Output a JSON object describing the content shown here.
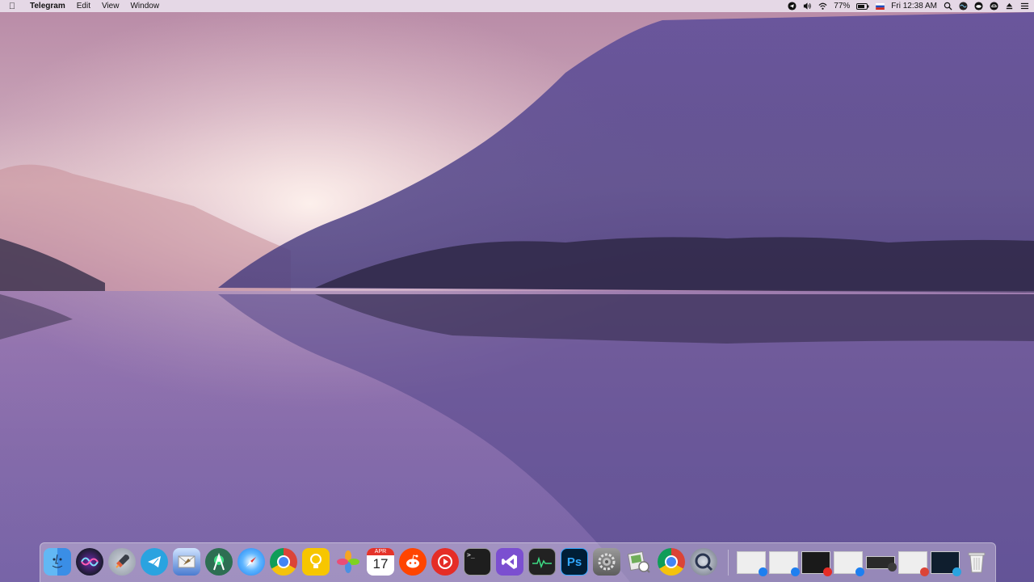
{
  "menubar": {
    "app_name": "Telegram",
    "menus": [
      "Edit",
      "View",
      "Window"
    ],
    "battery_percent": "77%",
    "clock": "Fri 12:38 AM",
    "status_icons": [
      "telegram-icon",
      "volume-icon",
      "wifi-icon",
      "battery-icon",
      "flag-icon",
      "search-icon",
      "siri-icon",
      "cloud-icon",
      "creative-cloud-icon",
      "eject-icon",
      "notification-center-icon"
    ]
  },
  "dock": {
    "apps": [
      {
        "name": "Finder",
        "icon": "finder-icon",
        "color": "#3a8ee6",
        "running": true
      },
      {
        "name": "Siri",
        "icon": "siri-icon",
        "color": "#1b1b2e",
        "running": false
      },
      {
        "name": "Launchpad",
        "icon": "launchpad-icon",
        "color": "#9aa2ad",
        "running": false
      },
      {
        "name": "Telegram",
        "icon": "telegram-icon",
        "color": "#2aa3e0",
        "running": true
      },
      {
        "name": "Mail",
        "icon": "mail-icon",
        "color": "#4a7bd0",
        "running": true
      },
      {
        "name": "Android Studio",
        "icon": "android-studio-icon",
        "color": "#3ddc84",
        "running": false
      },
      {
        "name": "Safari",
        "icon": "safari-icon",
        "color": "#1e7ff0",
        "running": true
      },
      {
        "name": "Chrome",
        "icon": "chrome-icon",
        "color": "#db4437",
        "running": false
      },
      {
        "name": "Tips",
        "icon": "lightbulb-icon",
        "color": "#f7c600",
        "running": false
      },
      {
        "name": "Photos",
        "icon": "photos-icon",
        "color": "#ffffff",
        "running": false
      },
      {
        "name": "Calendar",
        "icon": "calendar-icon",
        "color": "#ffffff",
        "running": false,
        "month": "APR",
        "day": "17"
      },
      {
        "name": "Reddit",
        "icon": "reddit-icon",
        "color": "#ff4500",
        "running": true
      },
      {
        "name": "YouTube",
        "icon": "youtube-icon",
        "color": "#e52d27",
        "running": true
      },
      {
        "name": "Terminal",
        "icon": "terminal-icon",
        "color": "#1e1e1e",
        "running": true
      },
      {
        "name": "Visual Studio",
        "icon": "visual-studio-icon",
        "color": "#7b4fd0",
        "running": false
      },
      {
        "name": "Activity Monitor",
        "icon": "activity-monitor-icon",
        "color": "#222222",
        "running": true
      },
      {
        "name": "Photoshop",
        "icon": "photoshop-icon",
        "color": "#001e36",
        "running": false,
        "label": "Ps"
      },
      {
        "name": "System Preferences",
        "icon": "gear-icon",
        "color": "#7d7d7d",
        "running": false
      },
      {
        "name": "Preview",
        "icon": "preview-icon",
        "color": "#e8e8e8",
        "running": false
      },
      {
        "name": "Chrome",
        "icon": "chrome-icon",
        "color": "#db4437",
        "running": true
      },
      {
        "name": "QuickTime",
        "icon": "quicktime-icon",
        "color": "#3b3b3b",
        "running": true
      }
    ],
    "minimized": [
      {
        "name": "minimized-window-1",
        "badge": "#1e7ff0"
      },
      {
        "name": "minimized-window-2",
        "badge": "#1e7ff0"
      },
      {
        "name": "minimized-window-3",
        "badge": "#e52d27"
      },
      {
        "name": "minimized-window-4",
        "badge": "#1e7ff0"
      },
      {
        "name": "minimized-window-5",
        "badge": "#3b3b3b"
      },
      {
        "name": "minimized-window-6",
        "badge": "#db4437"
      },
      {
        "name": "minimized-window-7",
        "badge": "#2aa3e0"
      }
    ],
    "trash": {
      "name": "Trash",
      "icon": "trash-icon"
    }
  }
}
